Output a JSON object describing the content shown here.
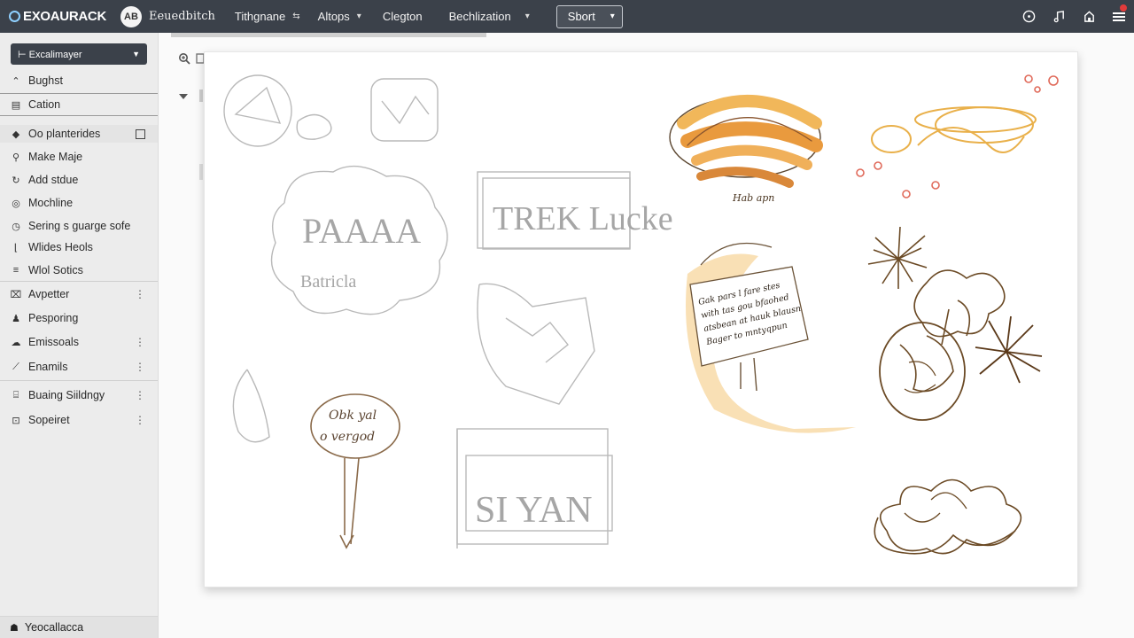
{
  "header": {
    "brand": "EXOAURACK",
    "logo_text": "AB",
    "workspace": "Eeuedbitch",
    "nav": [
      {
        "label": "Tithgnane",
        "caret": "⇆"
      },
      {
        "label": "Altops",
        "caret": "▾"
      },
      {
        "label": "Clegton",
        "caret": ""
      },
      {
        "label": "Bechlization",
        "caret": "▾"
      }
    ],
    "sort_label": "Sbort"
  },
  "top_icons": [
    "clock-icon",
    "music-icon",
    "home-icon",
    "menu-icon"
  ],
  "sidebar": {
    "select_label": "Excalimayer",
    "items": [
      {
        "label": "Bughst",
        "icon": "⌃"
      },
      {
        "label": "Cation",
        "icon": "▤"
      },
      {
        "label": "Oo planterides",
        "icon": "◆"
      },
      {
        "label": "Make Maje",
        "icon": "⚲"
      },
      {
        "label": "Add stdue",
        "icon": "↻"
      },
      {
        "label": "Mochline",
        "icon": "◎"
      },
      {
        "label": "Sering s guarge sofe",
        "icon": "◷"
      },
      {
        "label": "Wlides Heols",
        "icon": "⌊"
      },
      {
        "label": "Wlol Sotics",
        "icon": "≡"
      },
      {
        "label": "Avpetter",
        "icon": "⌧"
      },
      {
        "label": "Pesporing",
        "icon": "♟"
      },
      {
        "label": "Emissoals",
        "icon": "☁"
      },
      {
        "label": "Enamils",
        "icon": "⟋"
      },
      {
        "label": "Buaing Siildngy",
        "icon": "⌸"
      },
      {
        "label": "Sopeiret",
        "icon": "⊡"
      }
    ],
    "footer": "Yeocallacca"
  },
  "canvas_sketch_text": {
    "cloud": "PAAAA",
    "cloud_sub": "Batricla",
    "box1": "TREK Lucke",
    "box2": "SI YAN",
    "pin_line1": "Obk yal",
    "pin_line2": "o vergod",
    "caption": "Hab apn",
    "note_line1": "Gak pars l fare stes",
    "note_line2": "with tas gou bfaohed",
    "note_line3": "atsbean at hauk blausn",
    "note_line4": "Bager to mntyqpun"
  },
  "colors": {
    "topbar": "#3b414a",
    "sidebar": "#ececec",
    "accent_orange": "#e9a33a",
    "sketch_brown": "#6b4a25"
  }
}
